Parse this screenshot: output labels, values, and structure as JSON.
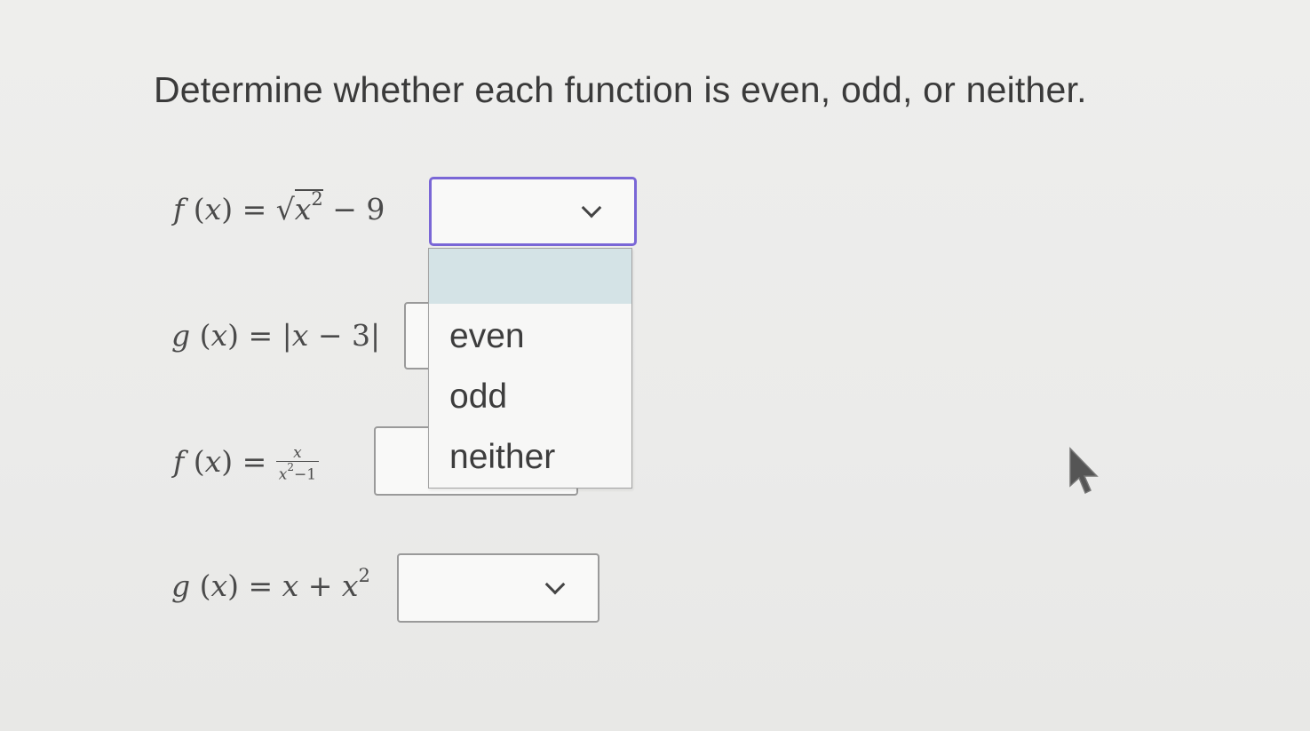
{
  "question": "Determine whether each function is even, odd, or neither.",
  "functions": [
    {
      "lhs": "f",
      "var": "x",
      "select_value": ""
    },
    {
      "lhs": "g",
      "var": "x",
      "select_value": ""
    },
    {
      "lhs": "f",
      "var": "x",
      "select_value": ""
    },
    {
      "lhs": "g",
      "var": "x",
      "select_value": ""
    }
  ],
  "dropdown": {
    "options": [
      "",
      "even",
      "odd",
      "neither"
    ]
  },
  "colors": {
    "focus_border": "#7a67d6",
    "highlight_option": "#d4e3e6"
  },
  "icons": {
    "chevron": "chevron-down-icon",
    "cursor": "mouse-pointer-icon"
  }
}
